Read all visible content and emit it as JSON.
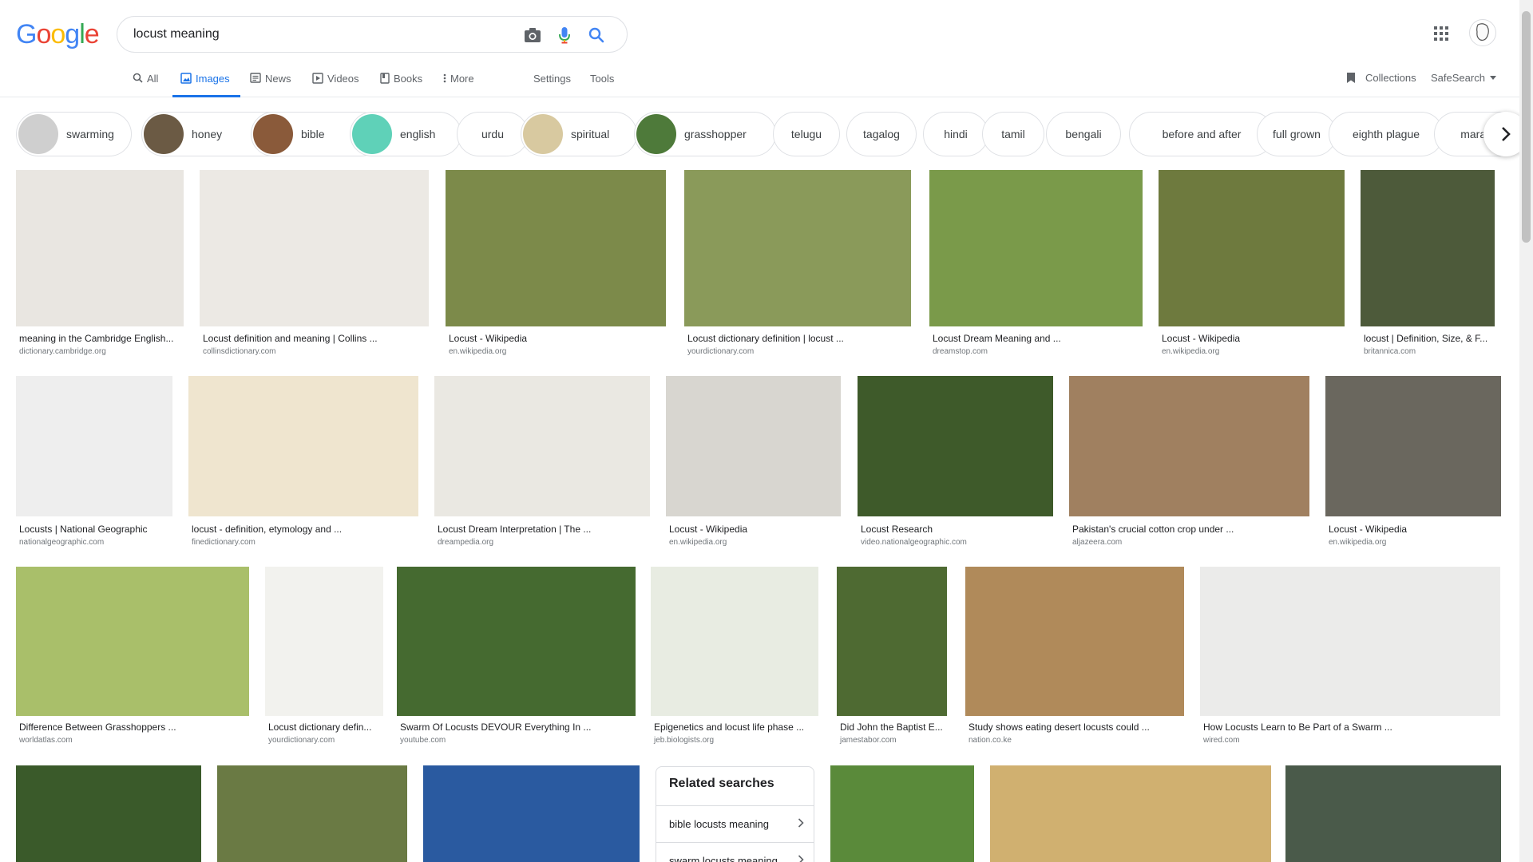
{
  "header": {
    "logo_letters": [
      {
        "ch": "G",
        "color": "#4285f4"
      },
      {
        "ch": "o",
        "color": "#ea4335"
      },
      {
        "ch": "o",
        "color": "#fbbc05"
      },
      {
        "ch": "g",
        "color": "#4285f4"
      },
      {
        "ch": "l",
        "color": "#34a853"
      },
      {
        "ch": "e",
        "color": "#ea4335"
      }
    ],
    "search_value": "locust meaning",
    "icons": [
      "camera-icon",
      "microphone-icon",
      "search-icon",
      "apps-icon"
    ]
  },
  "tabs": {
    "all": "All",
    "images": "Images",
    "news": "News",
    "videos": "Videos",
    "books": "Books",
    "more": "More",
    "settings": "Settings",
    "tools": "Tools",
    "collections": "Collections",
    "safesearch": "SafeSearch"
  },
  "chips": [
    {
      "label": "swarming",
      "thumb": "#cfcfcf"
    },
    {
      "label": "honey",
      "thumb": "#6b5a44"
    },
    {
      "label": "bible",
      "thumb": "#8a5a3a"
    },
    {
      "label": "english",
      "thumb": "#5fd1b8"
    },
    {
      "label": "urdu",
      "thumb": ""
    },
    {
      "label": "spiritual",
      "thumb": "#d8c9a0"
    },
    {
      "label": "grasshopper",
      "thumb": "#4e7a3a"
    },
    {
      "label": "telugu",
      "thumb": ""
    },
    {
      "label": "tagalog",
      "thumb": ""
    },
    {
      "label": "hindi",
      "thumb": ""
    },
    {
      "label": "tamil",
      "thumb": ""
    },
    {
      "label": "bengali",
      "thumb": ""
    },
    {
      "label": "before and after",
      "thumb": ""
    },
    {
      "label": "full grown",
      "thumb": ""
    },
    {
      "label": "eighth plague",
      "thumb": ""
    },
    {
      "label": "marath",
      "thumb": ""
    }
  ],
  "results_row1": [
    {
      "title": "meaning in the Cambridge English...",
      "source": "dictionary.cambridge.org",
      "color": "#e9e6e1"
    },
    {
      "title": "Locust definition and meaning | Collins ...",
      "source": "collinsdictionary.com",
      "color": "#ece9e4"
    },
    {
      "title": "Locust - Wikipedia",
      "source": "en.wikipedia.org",
      "color": "#7c8a4a"
    },
    {
      "title": "Locust dictionary definition | locust ...",
      "source": "yourdictionary.com",
      "color": "#8a9a5a"
    },
    {
      "title": "Locust Dream Meaning and ...",
      "source": "dreamstop.com",
      "color": "#7a9a4a"
    },
    {
      "title": "Locust - Wikipedia",
      "source": "en.wikipedia.org",
      "color": "#6e7a3e"
    },
    {
      "title": "locust | Definition, Size, & F...",
      "source": "britannica.com",
      "color": "#4d5a3a"
    }
  ],
  "results_row2": [
    {
      "title": "Locusts | National Geographic",
      "source": "nationalgeographic.com",
      "color": "#eeeeee"
    },
    {
      "title": "locust - definition, etymology and ...",
      "source": "finedictionary.com",
      "color": "#efe5cf"
    },
    {
      "title": "Locust Dream Interpretation | The ...",
      "source": "dreampedia.org",
      "color": "#eae8e2"
    },
    {
      "title": "Locust - Wikipedia",
      "source": "en.wikipedia.org",
      "color": "#d8d6d0"
    },
    {
      "title": "Locust Research",
      "source": "video.nationalgeographic.com",
      "color": "#3e5a2a"
    },
    {
      "title": "Pakistan's crucial cotton crop under ...",
      "source": "aljazeera.com",
      "color": "#a08060"
    },
    {
      "title": "Locust - Wikipedia",
      "source": "en.wikipedia.org",
      "color": "#6a675e"
    }
  ],
  "results_row3": [
    {
      "title": "Difference Between Grasshoppers ...",
      "source": "worldatlas.com",
      "color": "#a9bf6a"
    },
    {
      "title": "Locust dictionary defin...",
      "source": "yourdictionary.com",
      "color": "#f2f2ee"
    },
    {
      "title": "Swarm Of Locusts DEVOUR Everything In ...",
      "source": "youtube.com",
      "color": "#456a30"
    },
    {
      "title": "Epigenetics and locust life phase ...",
      "source": "jeb.biologists.org",
      "color": "#e8ece2"
    },
    {
      "title": "Did John the Baptist E...",
      "source": "jamestabor.com",
      "color": "#4e6a32"
    },
    {
      "title": "Study shows eating desert locusts could ...",
      "source": "nation.co.ke",
      "color": "#b08a5a"
    },
    {
      "title": "How Locusts Learn to Be Part of a Swarm ...",
      "source": "wired.com",
      "color": "#ebebea"
    }
  ],
  "results_row4_colors": [
    "#3a5a2a",
    "#6a7a44",
    "#2a5aa0",
    "#5a8a3a",
    "#d0b070",
    "#4a5a4a"
  ],
  "related": {
    "title": "Related searches",
    "items": [
      "bible locusts meaning",
      "swarm locusts meaning"
    ]
  }
}
